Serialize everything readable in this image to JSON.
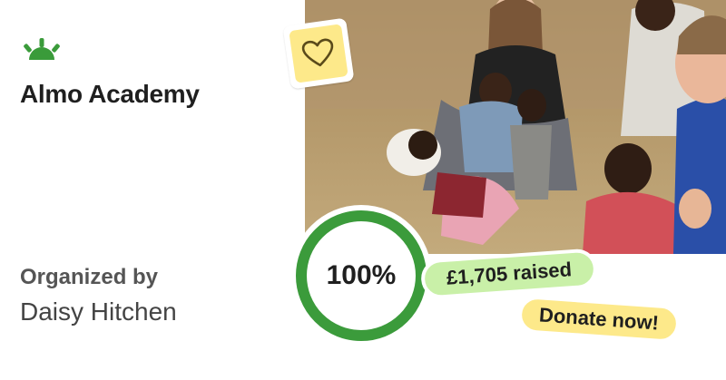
{
  "fundraiser": {
    "title": "Almo Academy",
    "organizer_label": "Organized by",
    "organizer_name": "Daisy Hitchen"
  },
  "progress": {
    "percent_label": "100%",
    "fraction": 1.0
  },
  "raised_label": "£1,705 raised",
  "donate_label": "Donate now!",
  "icons": {
    "logo": "sprout-logo-icon",
    "heart": "heart-icon"
  },
  "colors": {
    "brand_green": "#3a9b3a",
    "progress_green": "#3b9b3b",
    "raised_bg": "#c9f0a8",
    "donate_bg": "#fde98a",
    "heart_bg": "#fde98a"
  }
}
